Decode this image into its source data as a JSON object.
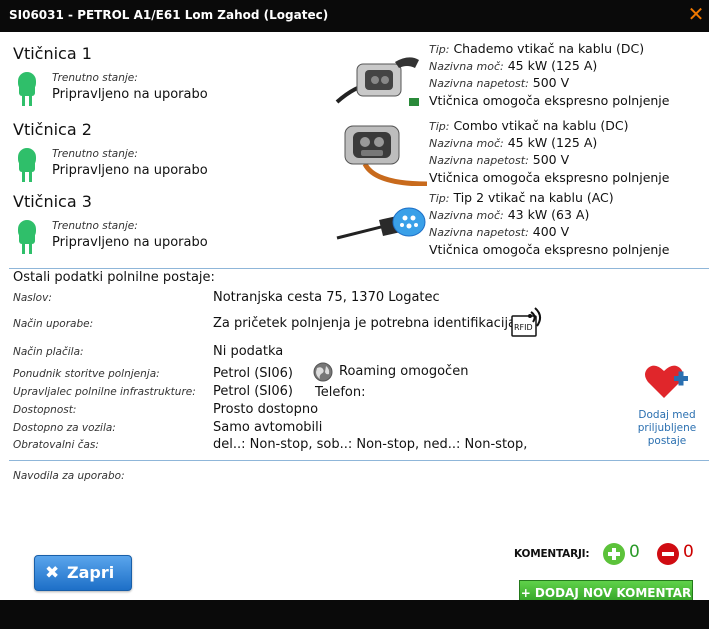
{
  "window": {
    "title": "SI06031 - PETROL A1/E61 Lom Zahod (Logatec)",
    "close_glyph": "✕"
  },
  "sockets": [
    {
      "name": "Vtičnica 1",
      "state_label": "Trenutno stanje:",
      "state_value": "Pripravljeno na uporabo",
      "tip_label": "Tip:",
      "tip_value": "Chademo vtikač na kablu (DC)",
      "power_label": "Nazivna moč:",
      "power_value": "45 kW (125 A)",
      "voltage_label": "Nazivna napetost:",
      "voltage_value": "500 V",
      "note": "Vtičnica omogoča ekspresno polnjenje"
    },
    {
      "name": "Vtičnica 2",
      "state_label": "Trenutno stanje:",
      "state_value": "Pripravljeno na uporabo",
      "tip_label": "Tip:",
      "tip_value": "Combo vtikač na kablu (DC)",
      "power_label": "Nazivna moč:",
      "power_value": "45 kW (125 A)",
      "voltage_label": "Nazivna napetost:",
      "voltage_value": "500 V",
      "note": "Vtičnica omogoča ekspresno polnjenje"
    },
    {
      "name": "Vtičnica 3",
      "state_label": "Trenutno stanje:",
      "state_value": "Pripravljeno na uporabo",
      "tip_label": "Tip:",
      "tip_value": "Tip 2 vtikač na kablu (AC)",
      "power_label": "Nazivna moč:",
      "power_value": "43 kW (63 A)",
      "voltage_label": "Nazivna napetost:",
      "voltage_value": "400 V",
      "note": "Vtičnica omogoča ekspresno polnjenje"
    }
  ],
  "station": {
    "section_title": "Ostali podatki polnilne postaje:",
    "address_label": "Naslov:",
    "address_value": "Notranjska cesta 75, 1370 Logatec",
    "usage_label": "Način uporabe:",
    "usage_value": "Za pričetek polnjenja je potrebna identifikacija:",
    "rfid_text": "RFID",
    "payment_label": "Način plačila:",
    "payment_value": "Ni podatka",
    "provider_label": "Ponudnik storitve polnjenja:",
    "provider_value": "Petrol (SI06)",
    "roaming_text": "Roaming omogočen",
    "operator_label": "Upravljalec polnilne infrastrukture:",
    "operator_value": "Petrol (SI06)",
    "phone_label": "Telefon:",
    "access_label": "Dostopnost:",
    "access_value": "Prosto dostopno",
    "vehicles_label": "Dostopno za vozila:",
    "vehicles_value": "Samo avtomobili",
    "hours_label": "Obratovalni čas:",
    "hours_value": "del..: Non-stop, sob..: Non-stop, ned..: Non-stop,",
    "instructions_label": "Navodila za uporabo:"
  },
  "favorite": {
    "line1": "Dodaj med",
    "line2": "priljubljene",
    "line3": "postaje"
  },
  "footer": {
    "close_label": "Zapri",
    "comments_label": "KOMENTARJI:",
    "likes": "0",
    "dislikes": "0",
    "add_comment_label": "+ DODAJ NOV KOMENTAR"
  },
  "colors": {
    "accent_blue": "#2a6fb0",
    "status_green": "#2fbf6a",
    "close_orange": "#f07800",
    "add_green": "#3fb52d"
  }
}
